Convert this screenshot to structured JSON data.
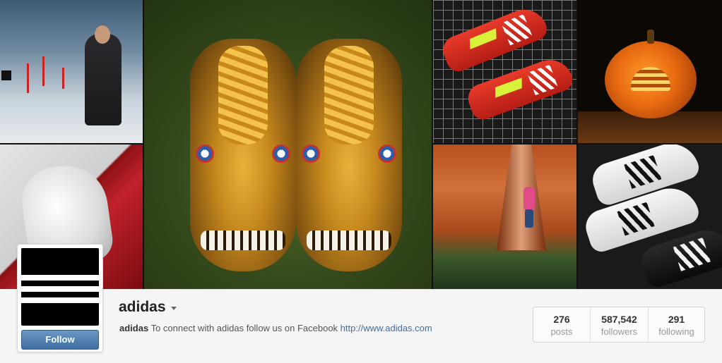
{
  "mosaic": {
    "tiles": [
      {
        "subject": "athlete-in-snow"
      },
      {
        "subject": "decorated-football-boots"
      },
      {
        "subject": "red-cleats-on-grid"
      },
      {
        "subject": "carved-pumpkin"
      },
      {
        "subject": "white-basketball-shoe"
      },
      {
        "subject": "rock-climber"
      },
      {
        "subject": "black-and-white-boots"
      }
    ]
  },
  "profile": {
    "username": "adidas",
    "follow_label": "Follow",
    "bio_name": "adidas",
    "bio_text": " To connect with adidas follow us on Facebook ",
    "bio_link": "http://www.adidas.com",
    "accent_color": "#3f6fa3"
  },
  "stats": [
    {
      "count": "276",
      "label": "posts"
    },
    {
      "count": "587,542",
      "label": "followers"
    },
    {
      "count": "291",
      "label": "following"
    }
  ],
  "icons": {
    "username_menu": "chevron-down-icon",
    "avatar_logo": "adidas-logo"
  }
}
